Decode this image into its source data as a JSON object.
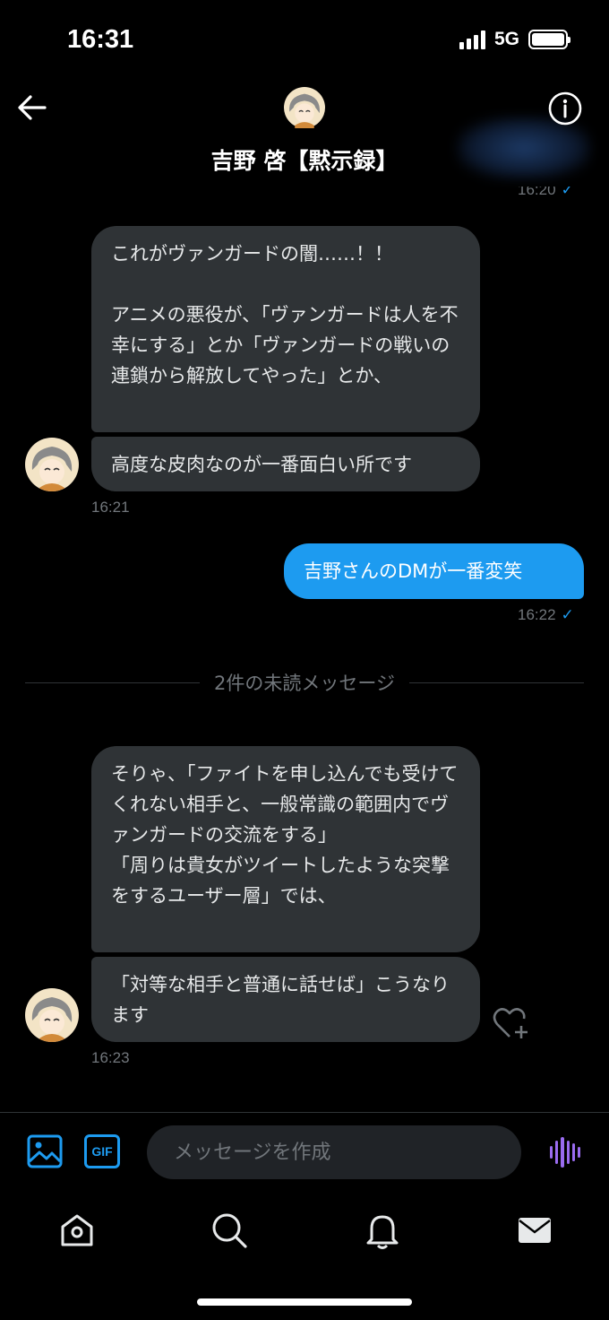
{
  "status_bar": {
    "time": "16:31",
    "network": "5G"
  },
  "header": {
    "name": "吉野 啓【黙示録】"
  },
  "messages": {
    "prev_timestamp": "16:20",
    "in1_part1": "これがヴァンガードの闇……！！\n\nアニメの悪役が、「ヴァンガードは人を不幸にする」とか「ヴァンガードの戦いの連鎖から解放してやった」とか、",
    "in1_part2": "高度な皮肉なのが一番面白い所です",
    "in1_timestamp": "16:21",
    "out1": "吉野さんのDMが一番変笑",
    "out1_timestamp": "16:22",
    "unread_divider": "2件の未読メッセージ",
    "in2_part1": "そりゃ、「ファイトを申し込んでも受けてくれない相手と、一般常識の範囲内でヴァンガードの交流をする」\n「周りは貴女がツイートしたような突撃をするユーザー層」では、",
    "in2_part2": "「対等な相手と普通に話せば」こうなります",
    "in2_timestamp": "16:23"
  },
  "composer": {
    "placeholder": "メッセージを作成",
    "gif_label": "GIF"
  },
  "icons": {
    "back": "arrow-left-icon",
    "info": "info-icon",
    "image": "image-icon",
    "voice": "voice-wave-icon",
    "heart": "heart-plus-icon",
    "home": "home-icon",
    "search": "search-icon",
    "notifications": "bell-icon",
    "messages": "envelope-icon"
  },
  "colors": {
    "accent": "#1d9bf0",
    "bubble_in": "#2f3336",
    "voice": "#9a6cf0"
  }
}
